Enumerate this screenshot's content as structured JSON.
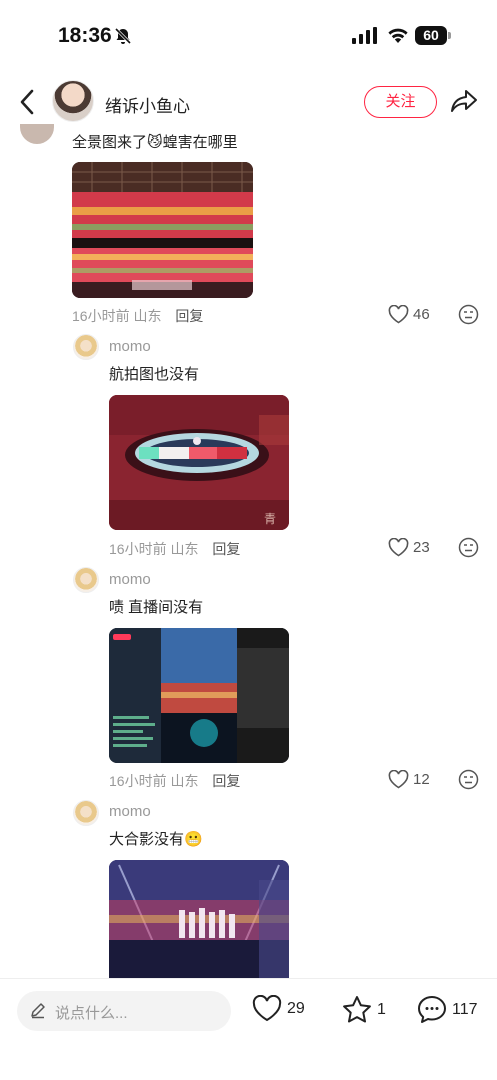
{
  "status_bar": {
    "time": "18:36",
    "battery": "60"
  },
  "header": {
    "user_name": "绪诉小鱼心",
    "follow_label": "关注"
  },
  "comments": [
    {
      "text": "全景图来了😼蝗害在哪里",
      "time": "16小时前",
      "location": "山东",
      "reply_label": "回复",
      "likes": "46"
    },
    {
      "author": "momo",
      "text": "航拍图也没有",
      "time": "16小时前",
      "location": "山东",
      "reply_label": "回复",
      "likes": "23"
    },
    {
      "author": "momo",
      "text": "啧 直播间没有",
      "time": "16小时前",
      "location": "山东",
      "reply_label": "回复",
      "likes": "12"
    },
    {
      "author": "momo",
      "text": "大合影没有😬"
    }
  ],
  "bottom_bar": {
    "placeholder": "说点什么...",
    "likes": "29",
    "stars": "1",
    "comments": "117"
  },
  "colors": {
    "accent": "#ff2442",
    "muted": "#999999"
  }
}
